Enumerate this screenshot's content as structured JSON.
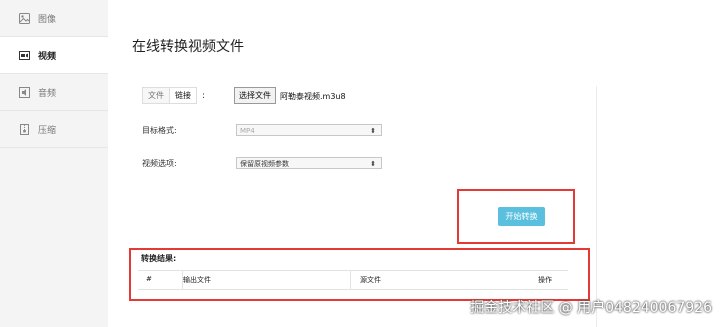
{
  "sidebar": {
    "items": [
      {
        "label": "图像",
        "icon": "image-icon",
        "active": false
      },
      {
        "label": "视频",
        "icon": "video-icon",
        "active": true
      },
      {
        "label": "音频",
        "icon": "audio-icon",
        "active": false
      },
      {
        "label": "压缩",
        "icon": "archive-icon",
        "active": false
      }
    ]
  },
  "main": {
    "title": "在线转换视频文件",
    "source_tabs": {
      "file": "文件",
      "link": "链接",
      "colon": ":"
    },
    "choose_file_label": "选择文件",
    "file_name": "阿勒泰视频.m3u8",
    "target_format_label": "目标格式:",
    "target_format_value": "MP4",
    "video_options_label": "视频选项:",
    "video_options_value": "保留原视频参数",
    "start_button_label": "开始转换",
    "results_label": "转换结果:",
    "table_headers": [
      "#",
      "输出文件",
      "源文件",
      "操作"
    ]
  },
  "watermark": "掘金技术社区 @ 用户048240067926",
  "colors": {
    "accent_button": "#5bc0de",
    "highlight_box": "#e53935"
  }
}
